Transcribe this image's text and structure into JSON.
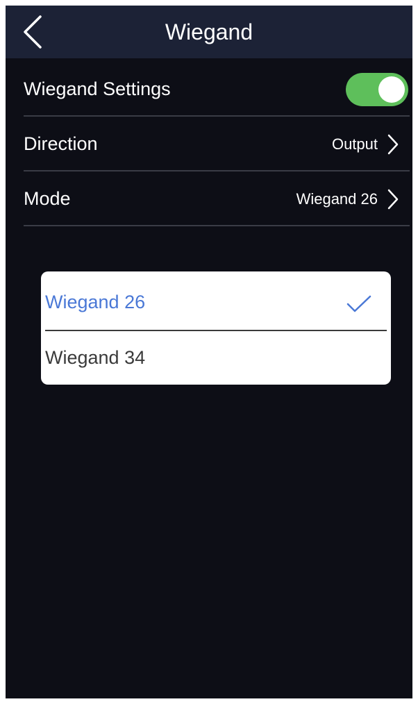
{
  "header": {
    "title": "Wiegand",
    "back_icon": "chevron-left-icon"
  },
  "settings": {
    "wiegand_settings": {
      "label": "Wiegand Settings",
      "enabled": true,
      "toggle_color": "#5ebf5b"
    },
    "direction": {
      "label": "Direction",
      "value": "Output"
    },
    "mode": {
      "label": "Mode",
      "value": "Wiegand 26"
    }
  },
  "mode_dropdown": {
    "options": [
      {
        "label": "Wiegand 26",
        "selected": true
      },
      {
        "label": "Wiegand 34",
        "selected": false
      }
    ],
    "selected_color": "#4a78d6",
    "check_icon": "checkmark-icon"
  },
  "colors": {
    "background": "#0d0e16",
    "header": "#1c2236"
  }
}
